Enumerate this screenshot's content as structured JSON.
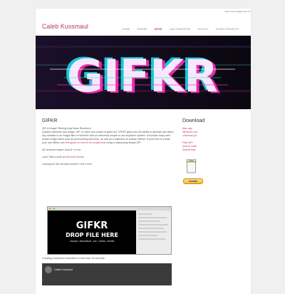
{
  "header": {
    "email": "caleb.kussmaul@gmail.com",
    "site_title": "Caleb Kussmaul",
    "nav": [
      "Home",
      "Tender",
      "GIFKR",
      "LAB Converter",
      "Bootlit",
      "Other Projects"
    ],
    "active_nav": "GIFKR"
  },
  "hero": {
    "text": "GIFKR"
  },
  "main": {
    "title": "GIFKR",
    "intro_line1": "GIF & Image Filtering KeyFrame Renderer)",
    "intro_body": "Quickly transform any image, GIF, or video into a work of glitch art. GIFKR gives you the ability to animate just about any variable in an image filter in real time with an extremely simple to use keyframe system. It includes many well known image filters such as pixel sorting and blurs, as well as a collection of custom effects. If you'd like to create your own filters, see",
    "intro_link": "this guide on how to do exactly that",
    "intro_tail": "using a ridiculously simple API.",
    "java_req": "All versions require Java 8+ to run.",
    "lost_prefix": "Lost? Take a look at",
    "lost_link": "this brief tutorial",
    "lost_suffix": ".",
    "old_prefix": "Looking for the old beta version? Get it",
    "old_link": "here",
    "old_suffix": ".",
    "screenshot_caption": "Creating a keyframe animation in less than 15 seconds:",
    "video_title": "Caleb Kussmaul"
  },
  "sidebar": {
    "title": "Download",
    "downloads": [
      "Mac app",
      "Windows exe",
      "Universal jar"
    ],
    "extras": [
      "Filter API",
      "Source code",
      "Submit bug"
    ],
    "donate_label": "Donate",
    "tip_label": "Tips"
  },
  "screenshot": {
    "line1": "GIFKR",
    "line2": "DROP FILE HERE",
    "line3": "•IMAGE •SEQUENCE •GIF •VIDEO •FILTER"
  }
}
